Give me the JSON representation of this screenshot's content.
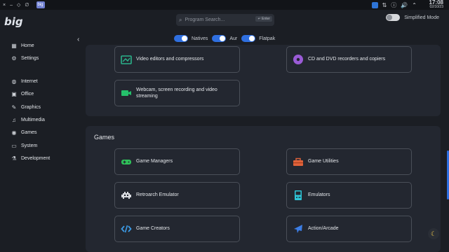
{
  "sysbar": {
    "controls": [
      "×",
      "–",
      "◇",
      "∅"
    ],
    "app_badge": "big",
    "tray": [
      "■",
      "⇅",
      "ⓘ",
      "🔊",
      "⌃"
    ],
    "time": "17:08",
    "date": "02/10/23"
  },
  "header": {
    "logo": "big",
    "search_placeholder": "Program Search...",
    "enter_hint": "↵ Enter",
    "simplified_mode": "Simplified Mode",
    "filters": [
      {
        "label": "Natives",
        "on": true
      },
      {
        "label": "Aur",
        "on": true
      },
      {
        "label": "Flatpak",
        "on": true
      }
    ]
  },
  "sidebar": {
    "items": [
      {
        "label": "Home",
        "icon": "grid-icon"
      },
      {
        "label": "Settings",
        "icon": "gear-icon"
      },
      {
        "label": "Internet",
        "icon": "globe-icon"
      },
      {
        "label": "Office",
        "icon": "briefcase-icon"
      },
      {
        "label": "Graphics",
        "icon": "brush-icon"
      },
      {
        "label": "Multimedia",
        "icon": "music-icon"
      },
      {
        "label": "Games",
        "icon": "gamepad-icon"
      },
      {
        "label": "System",
        "icon": "monitor-icon"
      },
      {
        "label": "Development",
        "icon": "flask-icon"
      }
    ]
  },
  "multimedia_cards": [
    {
      "label": "Video editors and compressors",
      "icon": "film-icon",
      "color": "#2bb38a"
    },
    {
      "label": "CD and DVD recorders and copiers",
      "icon": "disc-icon",
      "color": "#9a5bd6"
    },
    {
      "label": "Webcam, screen recording and video streaming",
      "icon": "camera-icon",
      "color": "#25c06b"
    }
  ],
  "games": {
    "title": "Games",
    "cards": [
      {
        "label": "Game Managers",
        "icon": "controller-icon",
        "color": "#2fc25a"
      },
      {
        "label": "Game Utilities",
        "icon": "toolbox-icon",
        "color": "#e0623a"
      },
      {
        "label": "Retroarch Emulator",
        "icon": "invader-icon",
        "color": "#d9dbe0"
      },
      {
        "label": "Emulators",
        "icon": "arcade-icon",
        "color": "#2ec4d6"
      },
      {
        "label": "Game Creators",
        "icon": "code-icon",
        "color": "#3c9be6"
      },
      {
        "label": "Action/Arcade",
        "icon": "jet-icon",
        "color": "#3c7ee6"
      }
    ]
  }
}
